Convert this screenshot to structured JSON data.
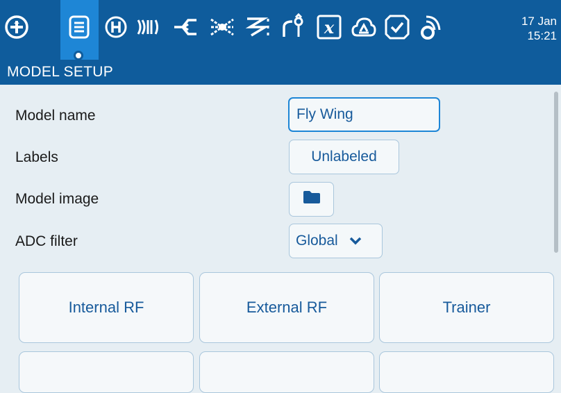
{
  "topbar": {
    "icons": [
      "radio-menu-icon",
      "model-setup-icon",
      "heli-icon",
      "flight-modes-icon",
      "inputs-icon",
      "mixes-icon",
      "outputs-icon",
      "curves-icon",
      "global-variables-icon",
      "logical-switches-icon",
      "special-functions-icon",
      "checklist-icon",
      "telemetry-icon"
    ],
    "date": "17 Jan",
    "time": "15:21",
    "bg_color": "#0f5c9c",
    "active_color": "#1e86d6"
  },
  "title": "MODEL SETUP",
  "rows": {
    "model_name": {
      "label": "Model name",
      "value": "Fly Wing"
    },
    "labels": {
      "label": "Labels",
      "value": "Unlabeled"
    },
    "model_image": {
      "label": "Model image",
      "icon": "folder-icon"
    },
    "adc_filter": {
      "label": "ADC filter",
      "value": "Global"
    }
  },
  "buttons": [
    "Internal RF",
    "External RF",
    "Trainer"
  ]
}
